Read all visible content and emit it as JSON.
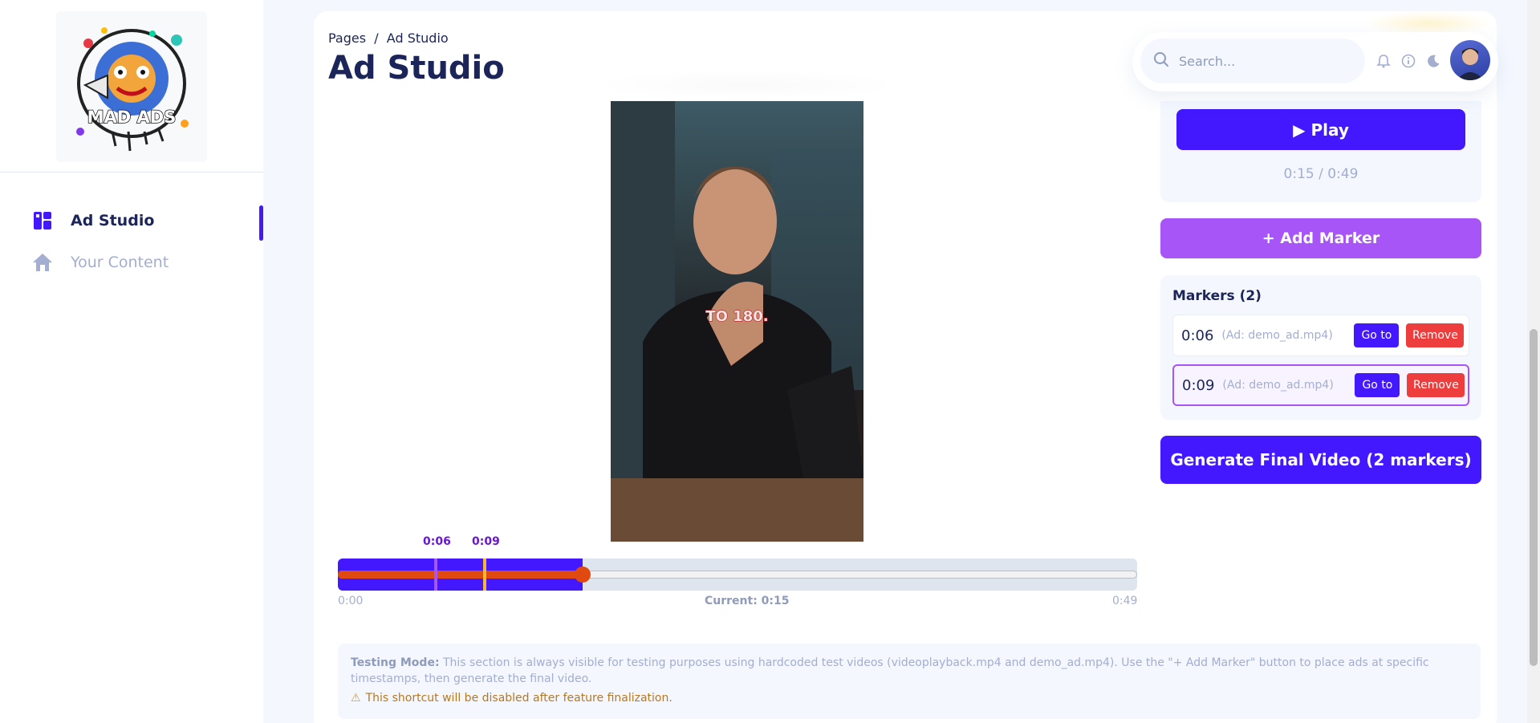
{
  "sidebar": {
    "logo_text": "MAD ADS",
    "items": [
      {
        "label": "Ad Studio",
        "icon": "dashboard-icon"
      },
      {
        "label": "Your Content",
        "icon": "home-icon"
      }
    ]
  },
  "header": {
    "breadcrumb": "Pages  /  Ad Studio",
    "title": "Ad Studio",
    "search_placeholder": "Search..."
  },
  "video": {
    "caption": "TO 180."
  },
  "timeline": {
    "start": "0:00",
    "end": "0:49",
    "current": "Current: 0:15",
    "progress_fraction": 0.306,
    "markers": [
      {
        "label": "0:06",
        "seconds": 6,
        "color": "#a855f7"
      },
      {
        "label": "0:09",
        "seconds": 9,
        "color": "#f5b82e"
      }
    ],
    "duration_seconds": 49
  },
  "player": {
    "play_label": "▶ Play",
    "time": "0:15 / 0:49"
  },
  "add_marker_label": "+ Add Marker",
  "markers_panel": {
    "title": "Markers (2)",
    "rows": [
      {
        "time": "0:06",
        "ad": "(Ad: demo_ad.mp4)",
        "goto": "Go to",
        "remove": "Remove"
      },
      {
        "time": "0:09",
        "ad": "(Ad: demo_ad.mp4)",
        "goto": "Go to",
        "remove": "Remove"
      }
    ]
  },
  "generate_label": "Generate Final Video (2 markers)",
  "info": {
    "bold": "Testing Mode:",
    "text": " This section is always visible for testing purposes using hardcoded test videos (videoplayback.mp4 and demo_ad.mp4). Use the \"+ Add Marker\" button to place ads at specific timestamps, then generate the final video.",
    "warning": "This shortcut will be disabled after feature finalization."
  },
  "colors": {
    "accent": "#4318ff",
    "purple": "#a855f7",
    "danger": "#ee3d3d",
    "progress": "#e0490f"
  }
}
